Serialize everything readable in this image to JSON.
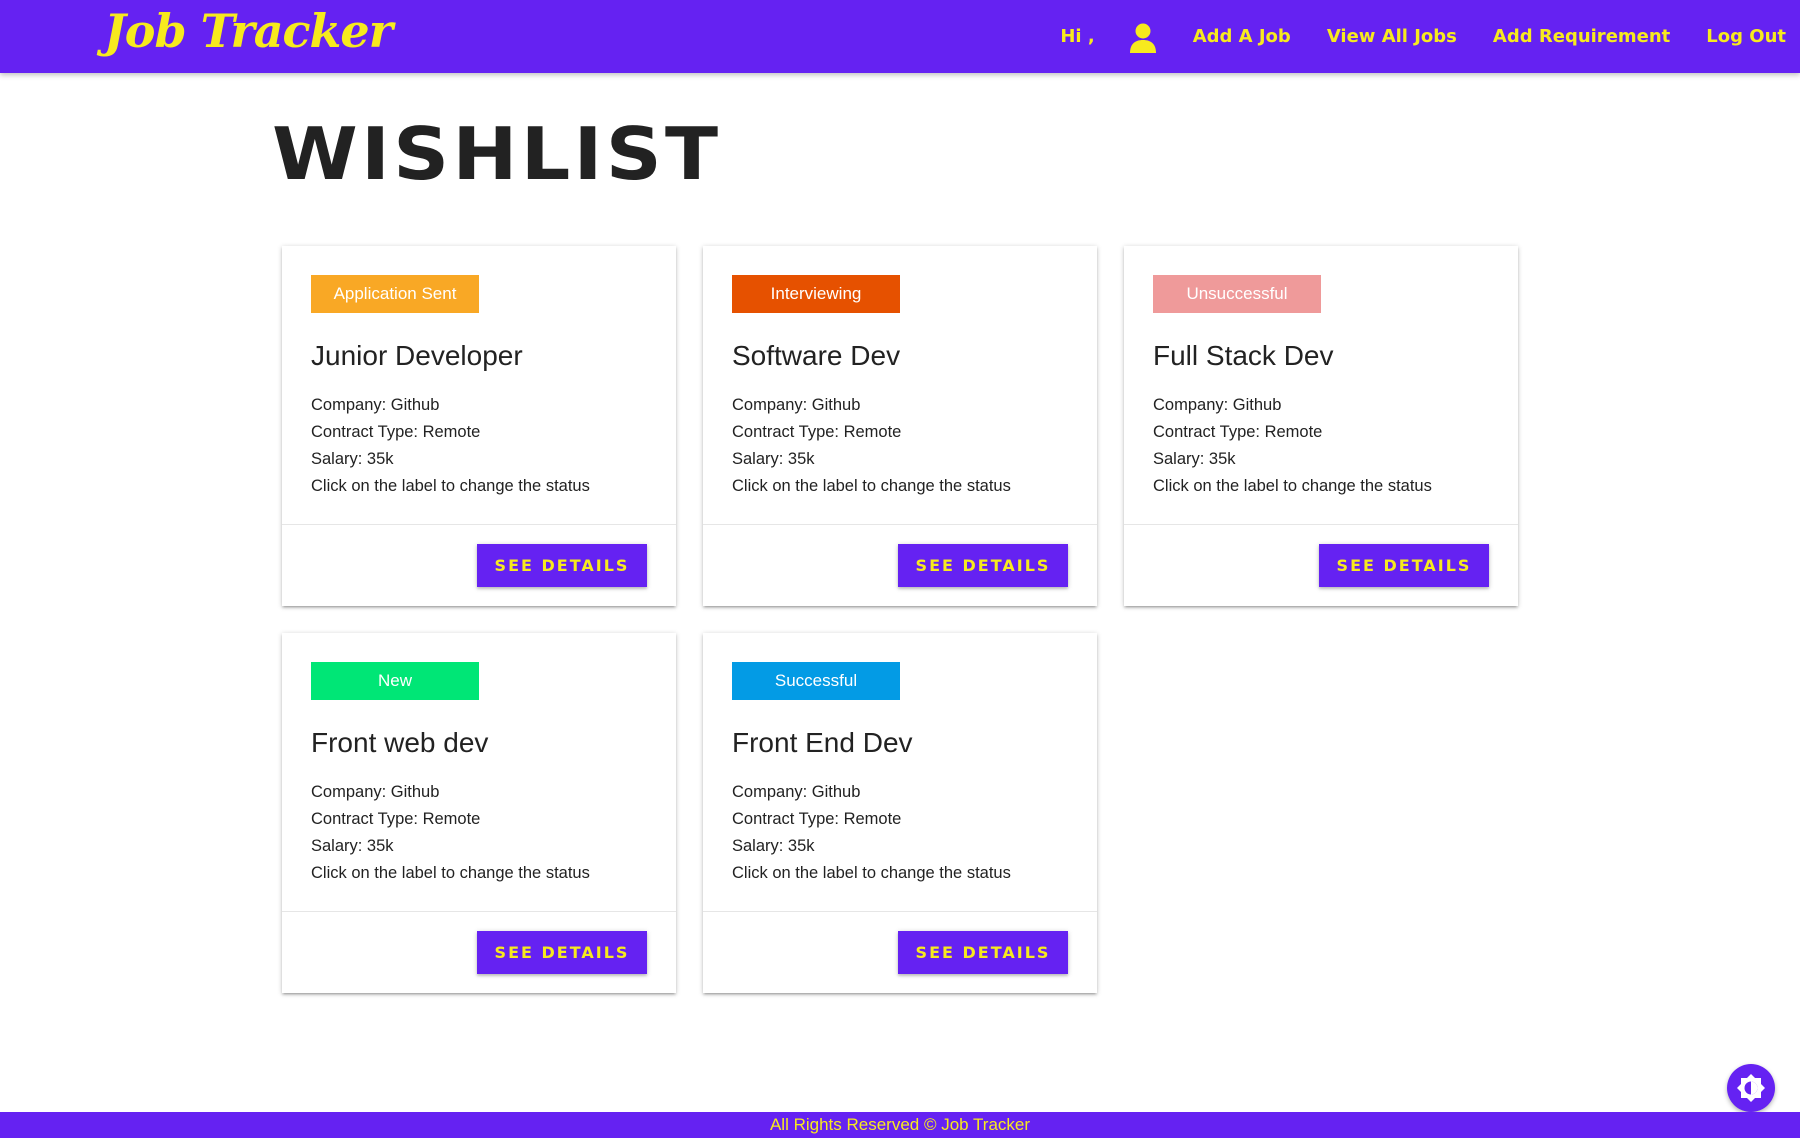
{
  "header": {
    "brand": "Job Tracker",
    "greeting": "Hi ,",
    "nav": [
      {
        "label": "Add A Job"
      },
      {
        "label": "View All Jobs"
      },
      {
        "label": "Add Requirement"
      },
      {
        "label": "Log Out"
      }
    ]
  },
  "page": {
    "title": "WISHLIST"
  },
  "jobs": [
    {
      "status": "Application Sent",
      "status_color": "#f9a825",
      "title": "Junior Developer",
      "company": "Company: Github",
      "contract": "Contract Type: Remote",
      "salary": "Salary: 35k",
      "hint": "Click on the label to change the status",
      "button": "SEE DETAILS"
    },
    {
      "status": "Interviewing",
      "status_color": "#e65100",
      "title": "Software Dev",
      "company": "Company: Github",
      "contract": "Contract Type: Remote",
      "salary": "Salary: 35k",
      "hint": "Click on the label to change the status",
      "button": "SEE DETAILS"
    },
    {
      "status": "Unsuccessful",
      "status_color": "#ef9a9a",
      "title": "Full Stack Dev",
      "company": "Company: Github",
      "contract": "Contract Type: Remote",
      "salary": "Salary: 35k",
      "hint": "Click on the label to change the status",
      "button": "SEE DETAILS"
    },
    {
      "status": "New",
      "status_color": "#00e676",
      "title": "Front web dev",
      "company": "Company: Github",
      "contract": "Contract Type: Remote",
      "salary": "Salary: 35k",
      "hint": "Click on the label to change the status",
      "button": "SEE DETAILS"
    },
    {
      "status": "Successful",
      "status_color": "#039be5",
      "title": "Front End Dev",
      "company": "Company: Github",
      "contract": "Contract Type: Remote",
      "salary": "Salary: 35k",
      "hint": "Click on the label to change the status",
      "button": "SEE DETAILS"
    }
  ],
  "footer": {
    "text": "All Rights Reserved © Job Tracker"
  },
  "theme": {
    "primary": "#6522f2",
    "accent": "#f7ea1e"
  },
  "icons": {
    "user": "user-icon",
    "theme_toggle": "brightness-icon"
  }
}
